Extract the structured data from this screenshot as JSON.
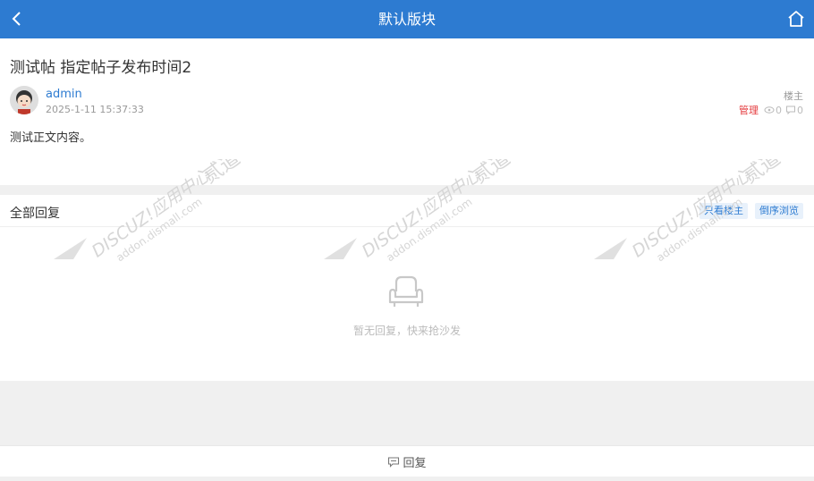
{
  "header": {
    "title": "默认版块",
    "back_icon": "back-chevron-icon",
    "home_icon": "home-icon",
    "background": "#2d7bd1"
  },
  "post": {
    "title": "测试帖 指定帖子发布时间2",
    "author": "admin",
    "date": "2025-1-11 15:37:33",
    "floor_label": "楼主",
    "manage_label": "管理",
    "views": "0",
    "replies": "0",
    "body": "测试正文内容。"
  },
  "replies": {
    "title": "全部回复",
    "only_owner_label": "只看楼主",
    "reverse_label": "倒序浏览",
    "empty_text": "暂无回复，快来抢沙发",
    "empty_icon": "sofa-icon"
  },
  "footer": {
    "reply_label": "回复",
    "reply_icon": "comment-icon"
  },
  "watermark": {
    "line1": "DISCUZ!应用中心",
    "line2": "addon.dismall.com",
    "brand": "贰道"
  },
  "colors": {
    "accent": "#2d7bd1",
    "danger": "#e4393c"
  }
}
